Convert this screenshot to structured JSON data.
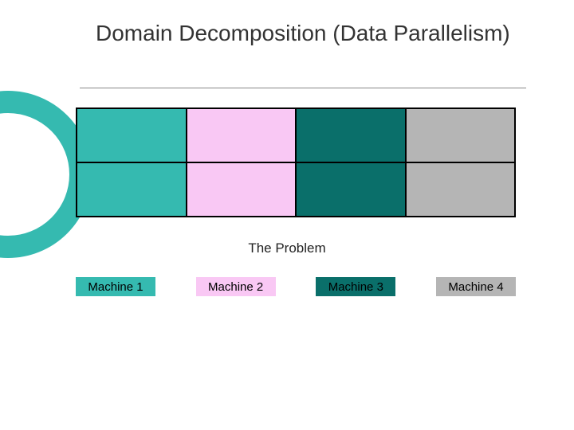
{
  "title": "Domain Decomposition (Data Parallelism)",
  "caption": "The Problem",
  "colors": {
    "teal_light": "#35bab0",
    "pink": "#f9c8f4",
    "teal_dark": "#0a6f6a",
    "gray": "#b5b5b5"
  },
  "machines": [
    {
      "label": "Machine 1",
      "color_key": "teal_light"
    },
    {
      "label": "Machine 2",
      "color_key": "pink"
    },
    {
      "label": "Machine 3",
      "color_key": "teal_dark"
    },
    {
      "label": "Machine 4",
      "color_key": "gray"
    }
  ]
}
